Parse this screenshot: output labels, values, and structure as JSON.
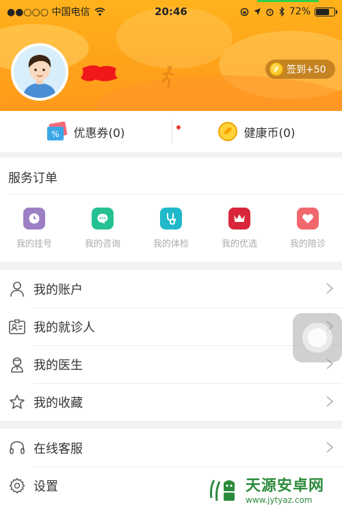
{
  "status_bar": {
    "carrier": "●●○○○ 中国电信",
    "time": "20:46",
    "battery": "72%",
    "battery_level": 0.72
  },
  "profile": {
    "checkin_label": "签到+50"
  },
  "rewards": {
    "coupon_label": "优惠券(0)",
    "coin_label": "健康币(0)"
  },
  "orders": {
    "title": "服务订单",
    "items": [
      {
        "label": "我的挂号",
        "icon": "clock-icon",
        "color": "#9d7fc4"
      },
      {
        "label": "我的咨询",
        "icon": "chat-icon",
        "color": "#25c192"
      },
      {
        "label": "我的体检",
        "icon": "stethoscope-icon",
        "color": "#20b9c9"
      },
      {
        "label": "我的优选",
        "icon": "crown-icon",
        "color": "#d9263a"
      },
      {
        "label": "我的陪诊",
        "icon": "heart-icon",
        "color": "#f0686c"
      }
    ]
  },
  "menu_main": [
    {
      "label": "我的账户",
      "icon": "user-icon"
    },
    {
      "label": "我的就诊人",
      "icon": "id-card-icon"
    },
    {
      "label": "我的医生",
      "icon": "doctor-icon"
    },
    {
      "label": "我的收藏",
      "icon": "star-icon"
    }
  ],
  "menu_support": [
    {
      "label": "在线客服",
      "icon": "headset-icon"
    },
    {
      "label": "设置",
      "icon": "gear-icon"
    }
  ],
  "watermark": {
    "title": "天源安卓网",
    "url": "www.jytyaz.com"
  },
  "colors": {
    "header": "#ffa31a",
    "accent_red": "#e43b2f"
  }
}
